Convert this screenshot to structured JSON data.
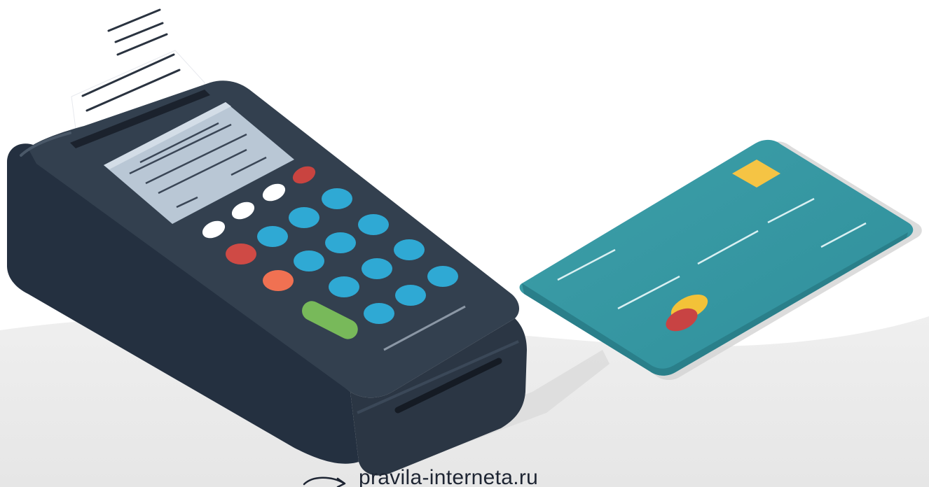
{
  "watermark": {
    "text": "pravila-interneta.ru"
  },
  "colors": {
    "terminal_body": "#2f3a48",
    "terminal_dark": "#232c38",
    "screen": "#b8c6d3",
    "key_blue": "#2eaad6",
    "key_red": "#d04a45",
    "key_orange": "#f07152",
    "key_green": "#77b85a",
    "key_white": "#ffffff",
    "card": "#3a9aa6",
    "card_chip": "#f5c444",
    "card_logo_red": "#c84343",
    "card_logo_yellow": "#f3c238",
    "floor": "#ebebeb"
  },
  "icons": {
    "terminal": "payment-terminal-icon",
    "receipt": "receipt-paper-icon",
    "card": "bank-card-icon"
  }
}
